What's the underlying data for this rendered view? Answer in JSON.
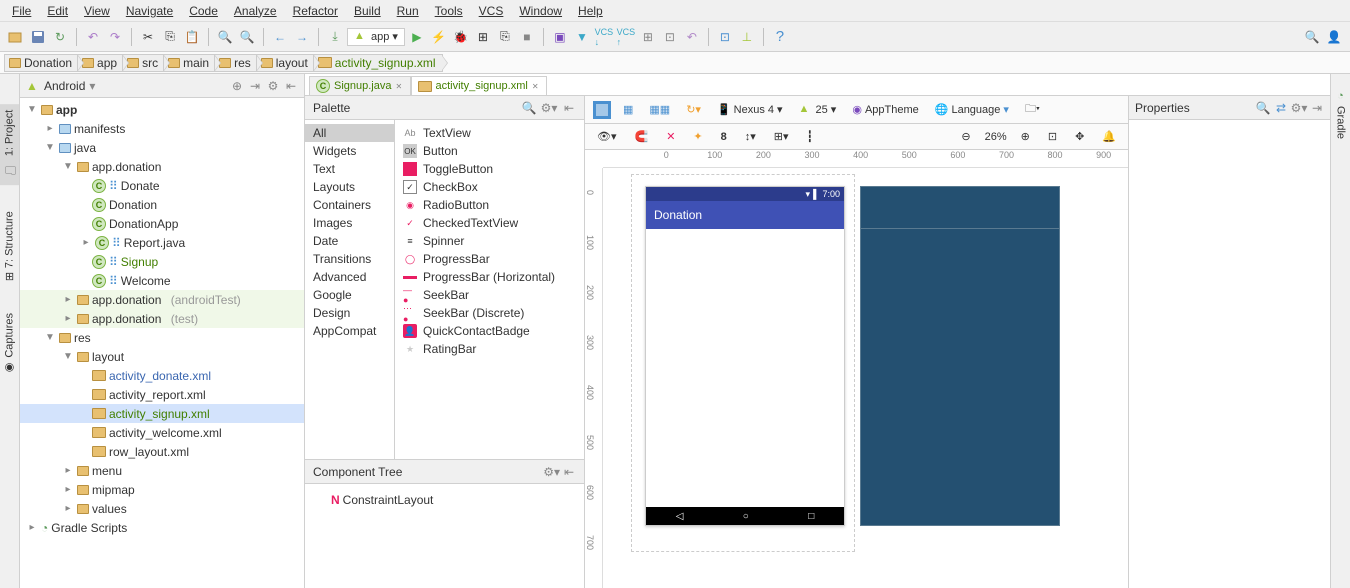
{
  "menubar": [
    "File",
    "Edit",
    "View",
    "Navigate",
    "Code",
    "Analyze",
    "Refactor",
    "Build",
    "Run",
    "Tools",
    "VCS",
    "Window",
    "Help"
  ],
  "toolbar_app_label": "app",
  "breadcrumbs": [
    "Donation",
    "app",
    "src",
    "main",
    "res",
    "layout",
    "activity_signup.xml"
  ],
  "side_tabs": {
    "project": "1: Project",
    "structure": "7: Structure",
    "captures": "Captures",
    "gradle": "Gradle"
  },
  "project_header": "Android",
  "tree": {
    "app": "app",
    "manifests": "manifests",
    "java": "java",
    "pkg": "app.donation",
    "donate": "Donate",
    "donation": "Donation",
    "donationApp": "DonationApp",
    "report": "Report.java",
    "signup": "Signup",
    "welcome": "Welcome",
    "pkg_test": "app.donation",
    "pkg_test_hint": "(androidTest)",
    "pkg_unit": "app.donation",
    "pkg_unit_hint": "(test)",
    "res": "res",
    "layout": "layout",
    "ad": "activity_donate.xml",
    "ar": "activity_report.xml",
    "as": "activity_signup.xml",
    "aw": "activity_welcome.xml",
    "rl": "row_layout.xml",
    "menu": "menu",
    "mipmap": "mipmap",
    "values": "values",
    "gradle": "Gradle Scripts"
  },
  "tabs": {
    "signup_java": "Signup.java",
    "activity_signup": "activity_signup.xml"
  },
  "palette": {
    "header": "Palette",
    "cats": [
      "All",
      "Widgets",
      "Text",
      "Layouts",
      "Containers",
      "Images",
      "Date",
      "Transitions",
      "Advanced",
      "Google",
      "Design",
      "AppCompat"
    ],
    "items": [
      "TextView",
      "Button",
      "ToggleButton",
      "CheckBox",
      "RadioButton",
      "CheckedTextView",
      "Spinner",
      "ProgressBar",
      "ProgressBar (Horizontal)",
      "SeekBar",
      "SeekBar (Discrete)",
      "QuickContactBadge",
      "RatingBar"
    ]
  },
  "component_tree": {
    "header": "Component Tree",
    "root": "ConstraintLayout"
  },
  "dc_toolbar": {
    "device": "Nexus 4",
    "api": "25",
    "theme": "AppTheme",
    "lang": "Language",
    "zoom": "26%",
    "eight": "8",
    "app_title": "Donation",
    "time": "7:00"
  },
  "properties_header": "Properties",
  "ruler_h": [
    "0",
    "100",
    "200",
    "300",
    "400",
    "500",
    "600",
    "700",
    "800",
    "900"
  ],
  "ruler_v": [
    "0",
    "100",
    "200",
    "300",
    "400",
    "500",
    "600",
    "700"
  ]
}
